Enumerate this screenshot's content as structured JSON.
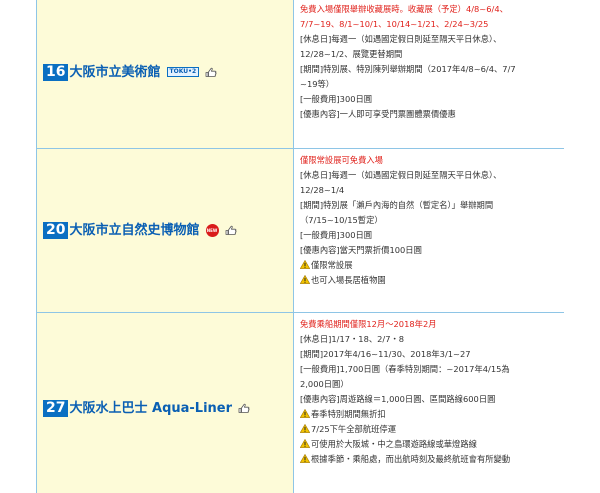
{
  "colors": {
    "name_text": "#0a5fb3",
    "number_bg": "#0a6fc2",
    "name_cell_bg": "#fdfbd8",
    "border": "#8ec5e6",
    "highlight_red": "#e0211b",
    "body_text": "#333333",
    "warning_yellow": "#f2c200"
  },
  "facilities": [
    {
      "number": "16",
      "name": "大阪市立美術館",
      "badge": "TOKU•2",
      "badge_type": "toku",
      "icon": "pointer-hand-icon",
      "lines": [
        {
          "text": "免費入場僅限舉辦收藏展時。收藏展（予定）4/8~6/4、",
          "red": true
        },
        {
          "text": "7/7~19、8/1~10/1、10/14~1/21、2/24~3/25",
          "red": true
        },
        {
          "text": "[休息日]每週一（如遇國定假日則延至隔天平日休息）、"
        },
        {
          "text": "12/28~1/2、展覽更替期間"
        },
        {
          "text": "[期間]特別展、特別陳列舉辦期間（2017年4/8~6/4、7/7"
        },
        {
          "text": "~19等）"
        },
        {
          "text": "[一般費用]300日圓"
        },
        {
          "text": "[優惠內容]一人即可享受門票團體票價優惠"
        }
      ]
    },
    {
      "number": "20",
      "name": "大阪市立自然史博物館",
      "badge": "NEW",
      "badge_type": "new",
      "icon": "pointer-hand-icon",
      "lines": [
        {
          "text": "僅限常設展可免費入場",
          "red": true
        },
        {
          "text": "[休息日]每週一（如遇國定假日則延至隔天平日休息）、"
        },
        {
          "text": "12/28~1/4"
        },
        {
          "text": "[期間]特別展「瀨戶內海的自然（暫定名）」舉辦期間"
        },
        {
          "text": "（7/15~10/15暫定）"
        },
        {
          "text": "[一般費用]300日圓"
        },
        {
          "text": "[優惠內容]當天門票折價100日圓"
        },
        {
          "text": "僅限常設展",
          "warn": true
        },
        {
          "text": "也可入場長居植物園",
          "warn": true
        }
      ]
    },
    {
      "number": "27",
      "name": "大阪水上巴士 Aqua-Liner",
      "badge": "",
      "badge_type": "",
      "icon": "pointer-hand-icon",
      "lines": [
        {
          "text": "免費乘船期間僅限12月～2018年2月",
          "red": true
        },
        {
          "text": "[休息日]1/17・18、2/7・8"
        },
        {
          "text": "[期間]2017年4/16~11/30、2018年3/1~27"
        },
        {
          "text": "[一般費用]1,700日圓（春季特別期間：~2017年4/15為"
        },
        {
          "text": "2,000日圓）"
        },
        {
          "text": "[優惠內容]周遊路線＝1,000日圓、區間路線600日圓"
        },
        {
          "text": "春季特別期間無折扣",
          "warn": true
        },
        {
          "text": "7/25下午全部航班停運",
          "warn": true
        },
        {
          "text": "可使用於大阪城・中之島環遊路線或華燈路線",
          "warn": true
        },
        {
          "text": "根據季節・乘船處，而出航時刻及最終航班會有所變動",
          "warn": true
        }
      ]
    }
  ]
}
